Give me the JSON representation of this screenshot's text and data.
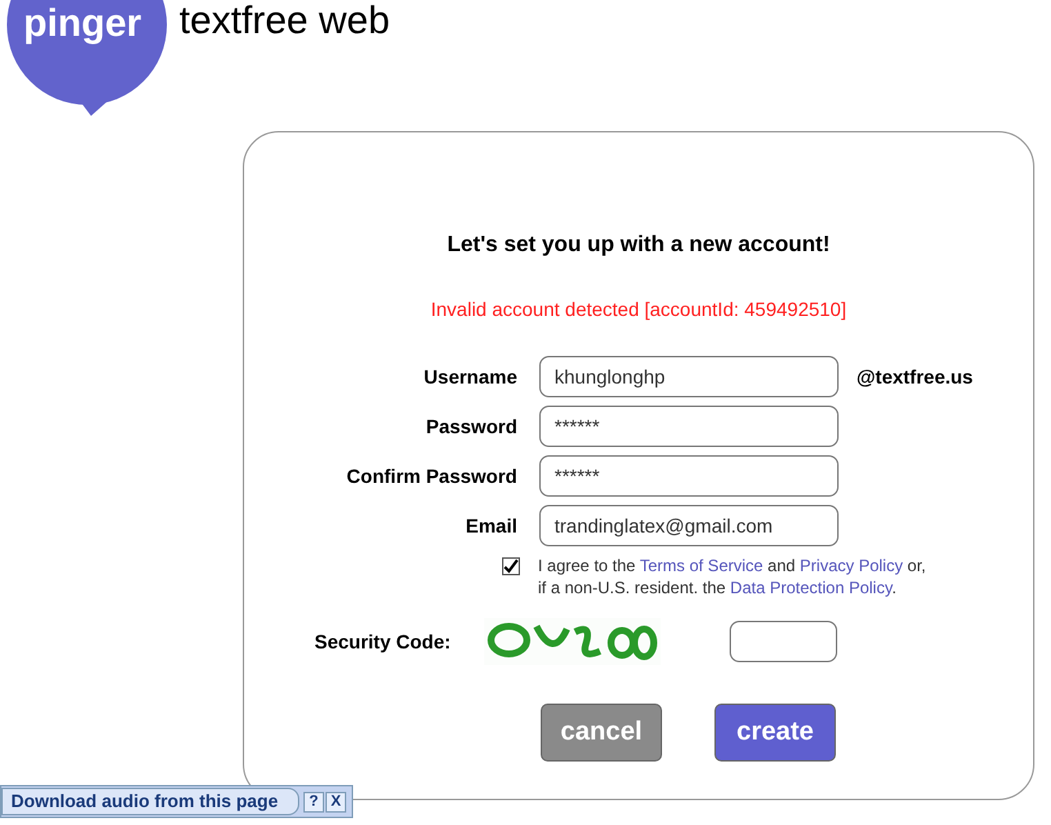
{
  "logo": {
    "brand": "pinger",
    "product": "textfree web"
  },
  "form": {
    "heading": "Let's set you up with a new account!",
    "error": "Invalid account detected [accountId: 459492510]",
    "fields": [
      {
        "label": "Username",
        "value": "khunglonghp",
        "suffix": "@textfree.us"
      },
      {
        "label": "Password",
        "value": "******"
      },
      {
        "label": "Confirm Password",
        "value": "******"
      },
      {
        "label": "Email",
        "value": "trandinglatex@gmail.com"
      }
    ],
    "agree": {
      "checked": true,
      "parts": [
        {
          "text": "I agree to the ",
          "link": false
        },
        {
          "text": "Terms of Service",
          "link": true
        },
        {
          "text": " and ",
          "link": false
        },
        {
          "text": "Privacy Policy",
          "link": true
        },
        {
          "text": " or,",
          "link": false
        }
      ],
      "parts2": [
        {
          "text": "if a non-U.S. resident. the ",
          "link": false
        },
        {
          "text": "Data Protection Policy",
          "link": true
        },
        {
          "text": ".",
          "link": false
        }
      ]
    },
    "security": {
      "label": "Security Code:"
    },
    "buttons": [
      {
        "label": "cancel",
        "kind": "secondary"
      },
      {
        "label": "create",
        "kind": "primary"
      }
    ]
  },
  "toolbar": {
    "label": "Download audio from this page",
    "help": "?",
    "close": "X"
  }
}
